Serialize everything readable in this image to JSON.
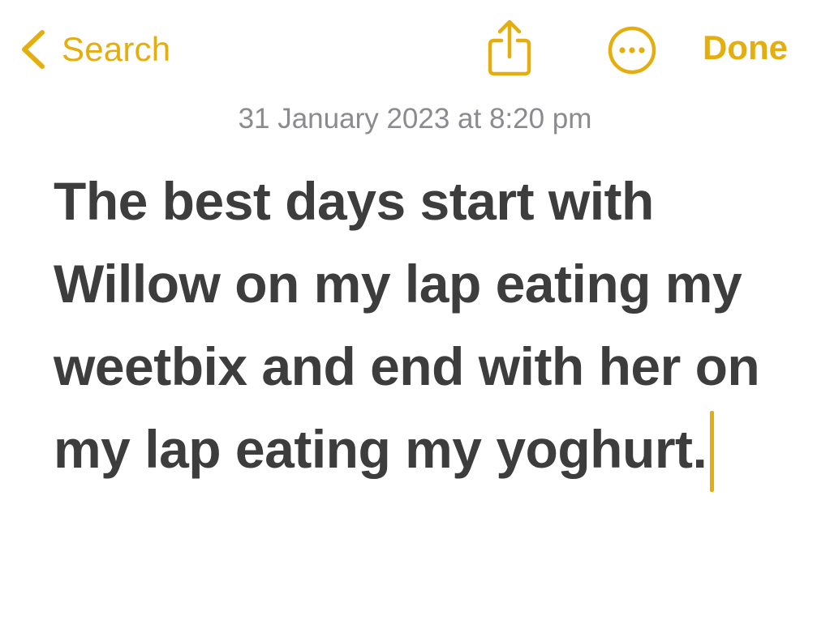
{
  "nav": {
    "back_label": "Search",
    "done_label": "Done",
    "share_icon": "share-icon",
    "more_icon": "more-options-icon",
    "back_icon": "chevron-left-icon"
  },
  "note": {
    "date": "31 January 2023 at 8:20 pm",
    "body": "The best days start with Willow on my lap eating my weetbix and end with her on my lap eating my yoghurt."
  },
  "colors": {
    "accent": "#e4ae0f",
    "date_text": "#8b8b8f",
    "body_text": "#3d3d3d",
    "background": "#ffffff"
  }
}
